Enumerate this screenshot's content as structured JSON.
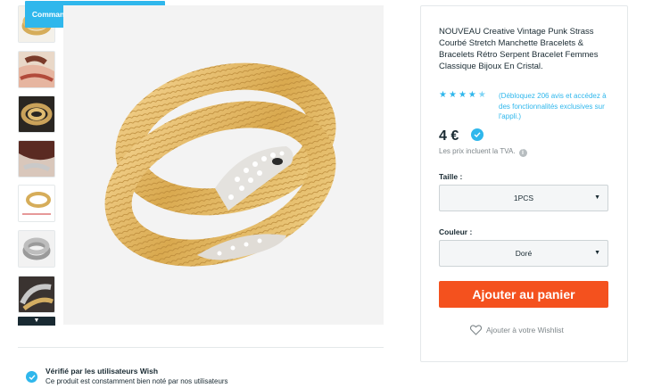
{
  "banner": {
    "similar_label": "Commandez des articles similaires"
  },
  "thumbnails": [
    {
      "name": "thumb-gold-coil"
    },
    {
      "name": "thumb-wrist-model"
    },
    {
      "name": "thumb-gold-detail"
    },
    {
      "name": "thumb-hair-model"
    },
    {
      "name": "thumb-gold-measure"
    },
    {
      "name": "thumb-silver-coil"
    },
    {
      "name": "thumb-silver-detail"
    }
  ],
  "thumb_more_icon": "▼",
  "product": {
    "title": "NOUVEAU Creative Vintage Punk Strass Courbé Stretch Manchette Bracelets & Bracelets Rétro Serpent Bracelet Femmes Classique Bijoux En Cristal.",
    "rating": 4.5,
    "reviews_text": "(Débloquez 206 avis et accédez à des fonctionnalités exclusives sur l'appli.)",
    "price": "4 €",
    "vat_text": "Les prix incluent la TVA.",
    "vat_info_icon": "i"
  },
  "options": {
    "size_label": "Taille :",
    "size_value": "1PCS",
    "color_label": "Couleur :",
    "color_value": "Doré"
  },
  "actions": {
    "add_to_cart": "Ajouter au panier",
    "wishlist": "Ajouter à votre Wishlist"
  },
  "verified": {
    "title": "Vérifié par les utilisateurs Wish",
    "subtitle": "Ce produit est constamment bien noté par nos utilisateurs"
  },
  "colors": {
    "accent": "#2fb7ec",
    "cta": "#f4511e",
    "text": "#192a32",
    "muted": "#7e868a"
  }
}
